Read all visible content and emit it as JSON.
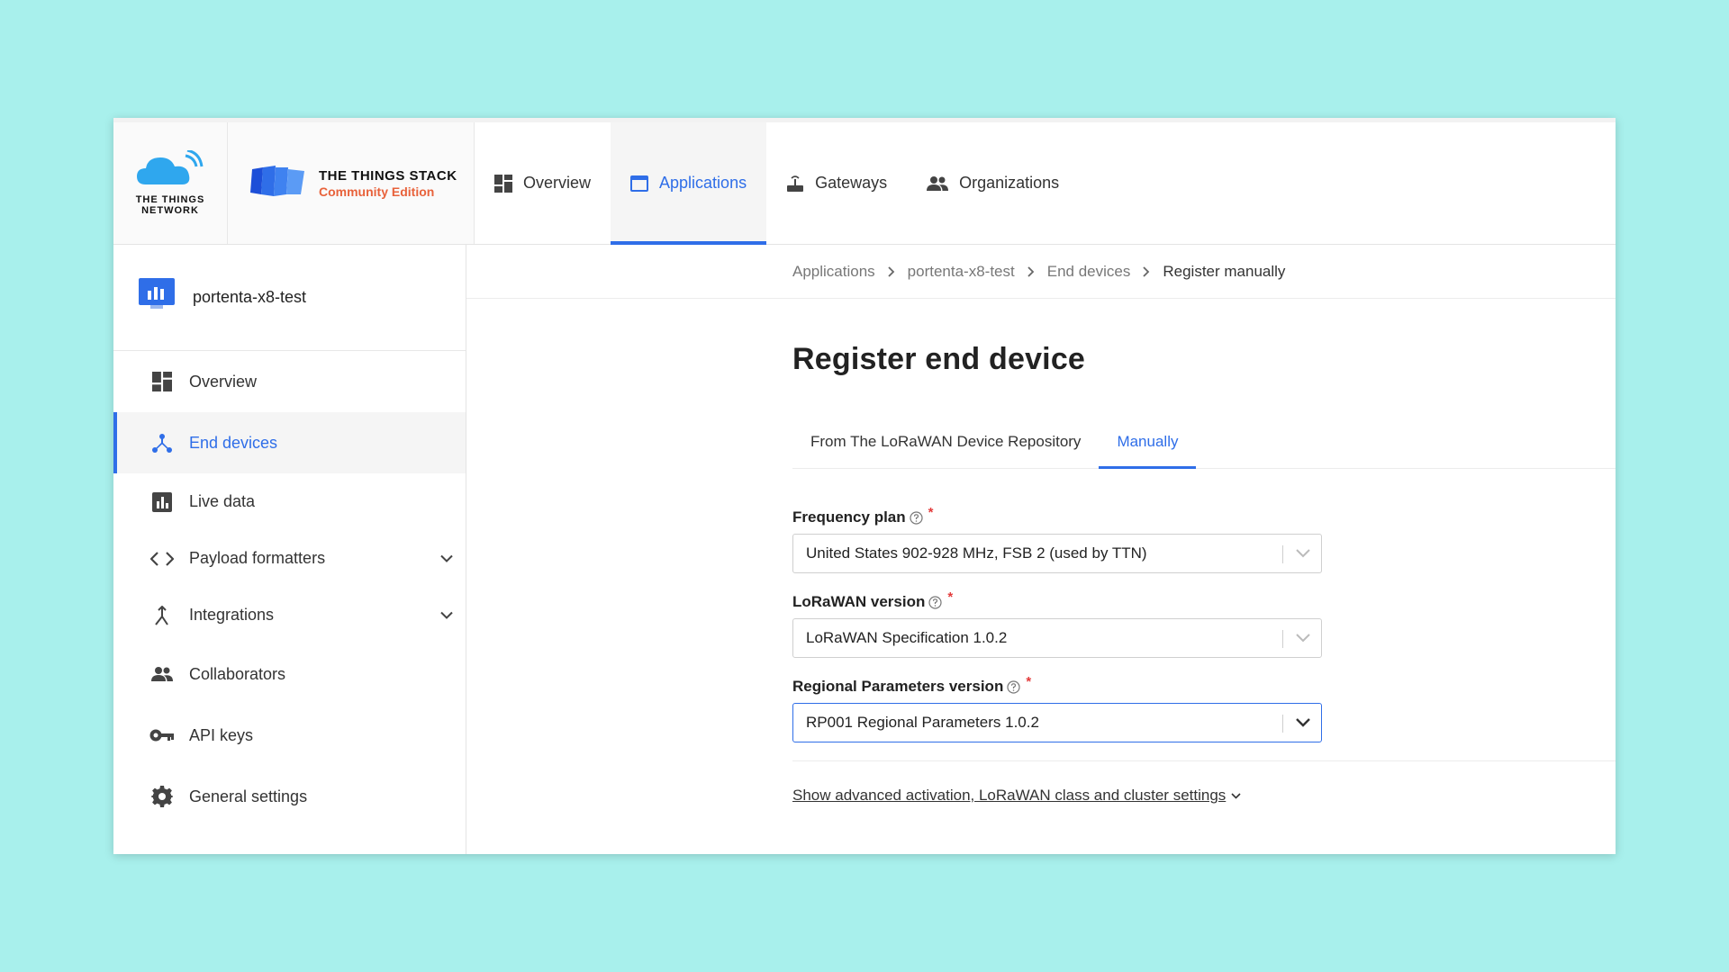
{
  "brand": {
    "ttn_line1": "THE THINGS",
    "ttn_line2": "NETWORK",
    "tts_title": "THE THINGS STACK",
    "tts_subtitle": "Community Edition"
  },
  "topnav": {
    "items": [
      {
        "label": "Overview",
        "icon": "dashboard-icon"
      },
      {
        "label": "Applications",
        "icon": "application-icon",
        "active": true
      },
      {
        "label": "Gateways",
        "icon": "gateway-icon"
      },
      {
        "label": "Organizations",
        "icon": "organization-icon"
      }
    ]
  },
  "sidebar": {
    "app_name": "portenta-x8-test",
    "items": [
      {
        "label": "Overview",
        "icon": "dashboard-icon"
      },
      {
        "label": "End devices",
        "icon": "devices-icon",
        "active": true
      },
      {
        "label": "Live data",
        "icon": "bar-chart-icon"
      },
      {
        "label": "Payload formatters",
        "icon": "code-icon",
        "expandable": true
      },
      {
        "label": "Integrations",
        "icon": "integration-icon",
        "expandable": true
      },
      {
        "label": "Collaborators",
        "icon": "people-icon"
      },
      {
        "label": "API keys",
        "icon": "key-icon"
      },
      {
        "label": "General settings",
        "icon": "gear-icon"
      }
    ]
  },
  "breadcrumb": {
    "items": [
      "Applications",
      "portenta-x8-test",
      "End devices",
      "Register manually"
    ]
  },
  "page": {
    "title": "Register end device",
    "tabs": [
      {
        "label": "From The LoRaWAN Device Repository"
      },
      {
        "label": "Manually",
        "active": true
      }
    ],
    "fields": [
      {
        "label": "Frequency plan",
        "value": "United States 902-928 MHz, FSB 2 (used by TTN)",
        "required_mark": "*"
      },
      {
        "label": "LoRaWAN version",
        "value": "LoRaWAN Specification 1.0.2",
        "required_mark": "*"
      },
      {
        "label": "Regional Parameters version",
        "value": "RP001 Regional Parameters 1.0.2",
        "required_mark": "*"
      }
    ],
    "advanced_link": "Show advanced activation, LoRaWAN class and cluster settings"
  },
  "colors": {
    "accent": "#2f6ee8",
    "background": "#a8f0ec",
    "required": "#e33b3b",
    "tts_subtitle": "#e8623b"
  }
}
